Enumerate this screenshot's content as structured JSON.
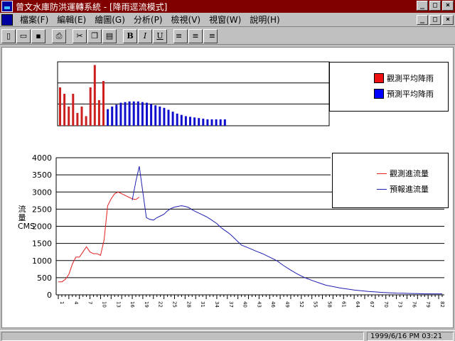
{
  "window": {
    "title": "曾文水庫防洪運轉系統 - [降雨逕流模式]",
    "min_glyph": "_",
    "max_glyph": "□",
    "close_glyph": "×"
  },
  "menu": {
    "items": [
      {
        "label": "檔案(F)",
        "name": "menu-file"
      },
      {
        "label": "編輯(E)",
        "name": "menu-edit"
      },
      {
        "label": "繪圖(G)",
        "name": "menu-graph"
      },
      {
        "label": "分析(P)",
        "name": "menu-analysis"
      },
      {
        "label": "檢視(V)",
        "name": "menu-view"
      },
      {
        "label": "視窗(W)",
        "name": "menu-window"
      },
      {
        "label": "說明(H)",
        "name": "menu-help"
      }
    ]
  },
  "toolbar": {
    "buttons": [
      {
        "icon": "new-icon",
        "glyph": "▯"
      },
      {
        "icon": "open-icon",
        "glyph": "▭"
      },
      {
        "icon": "save-icon",
        "glyph": "▪"
      },
      {
        "icon": "print-icon",
        "glyph": "⎙"
      },
      {
        "icon": "cut-icon",
        "glyph": "✂"
      },
      {
        "icon": "copy-icon",
        "glyph": "❐"
      },
      {
        "icon": "paste-icon",
        "glyph": "▤"
      },
      {
        "icon": "bold-icon",
        "glyph": "B"
      },
      {
        "icon": "italic-icon",
        "glyph": "I"
      },
      {
        "icon": "underline-icon",
        "glyph": "U"
      },
      {
        "icon": "align-left-icon",
        "glyph": "≡"
      },
      {
        "icon": "align-center-icon",
        "glyph": "≡"
      },
      {
        "icon": "align-right-icon",
        "glyph": "≡"
      }
    ]
  },
  "status": {
    "datetime": "1999/6/16  PM 03:21"
  },
  "chart_data": [
    {
      "type": "bar",
      "title": "",
      "legend_position": "right",
      "grid": true,
      "series": [
        {
          "name": "觀測平均降雨",
          "color": "#cc2020",
          "values": [
            0.6,
            0.5,
            0.3,
            0.5,
            0.2,
            0.3,
            0.15,
            0.6,
            0.95,
            0.4,
            0.7
          ]
        },
        {
          "name": "預測平均降雨",
          "color": "#1010cc",
          "values": [
            0.26,
            0.3,
            0.33,
            0.36,
            0.37,
            0.38,
            0.38,
            0.38,
            0.37,
            0.36,
            0.34,
            0.32,
            0.3,
            0.28,
            0.25,
            0.22,
            0.19,
            0.17,
            0.15,
            0.14,
            0.13,
            0.12,
            0.11,
            0.1,
            0.1,
            0.1,
            0.1,
            0.1
          ]
        }
      ]
    },
    {
      "type": "line",
      "title": "",
      "ylabel": "流量CMS",
      "ylim": [
        0,
        4000
      ],
      "yticks": [
        0,
        500,
        1000,
        1500,
        2000,
        2500,
        3000,
        3500,
        4000
      ],
      "grid": true,
      "legend_position": "top-right",
      "x_tick_count": 110,
      "x_labels": [
        "1",
        "4",
        "7",
        "10",
        "13",
        "16",
        "19",
        "22",
        "25",
        "28",
        "31",
        "34",
        "37",
        "40",
        "43",
        "46",
        "49",
        "52",
        "55",
        "58",
        "61",
        "64",
        "67",
        "70",
        "73",
        "76",
        "79",
        "82"
      ],
      "series": [
        {
          "name": "觀測進流量",
          "color": "#e02020",
          "x": [
            0,
            1,
            2,
            3,
            4,
            5,
            6,
            7,
            8,
            9,
            10,
            11,
            12,
            13,
            14,
            15,
            16,
            17,
            18,
            19,
            20,
            21,
            22,
            23
          ],
          "y": [
            380,
            380,
            450,
            600,
            900,
            1100,
            1100,
            1250,
            1400,
            1250,
            1200,
            1200,
            1150,
            1600,
            2600,
            2800,
            2950,
            3000,
            2950,
            2900,
            2850,
            2800,
            2780,
            2850
          ]
        },
        {
          "name": "預報進流量",
          "color": "#2020b0",
          "x": [
            21,
            22,
            23,
            24,
            25,
            26,
            27,
            28,
            29,
            30,
            31,
            32,
            33,
            34,
            35,
            36,
            37,
            38,
            39,
            40,
            41,
            42,
            43,
            44,
            45,
            46,
            47,
            48,
            49,
            50,
            52,
            54,
            56,
            58,
            60,
            62,
            64,
            66,
            68,
            70,
            72,
            74,
            76,
            78,
            80,
            82,
            84,
            86,
            88,
            90,
            92,
            94,
            96,
            98,
            100,
            102,
            104,
            106,
            108,
            109
          ],
          "y": [
            2760,
            3300,
            3750,
            3000,
            2250,
            2200,
            2180,
            2250,
            2300,
            2350,
            2450,
            2520,
            2560,
            2580,
            2600,
            2580,
            2550,
            2480,
            2430,
            2380,
            2330,
            2280,
            2220,
            2150,
            2080,
            1980,
            1900,
            1830,
            1750,
            1650,
            1450,
            1370,
            1280,
            1200,
            1100,
            1000,
            850,
            720,
            600,
            500,
            420,
            350,
            280,
            240,
            200,
            170,
            140,
            120,
            100,
            85,
            70,
            60,
            50,
            45,
            40,
            35,
            30,
            30,
            30,
            30
          ]
        }
      ]
    }
  ]
}
